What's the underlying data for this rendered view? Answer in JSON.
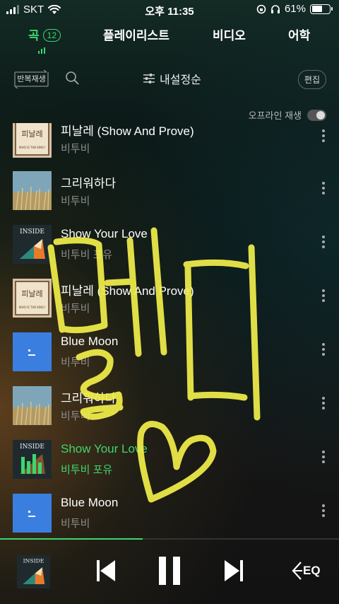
{
  "status_bar": {
    "carrier": "SKT",
    "time": "오후 11:35",
    "battery": "61%",
    "battery_level": 0.61
  },
  "tabs": [
    {
      "label": "곡",
      "badge": "12",
      "active": true
    },
    {
      "label": "플레이리스트"
    },
    {
      "label": "비디오"
    },
    {
      "label": "어학"
    }
  ],
  "toolbar": {
    "repeat_label": "반복재생",
    "sort_label": "내설정순",
    "edit_label": "편집"
  },
  "offline": {
    "label": "오프라인 재생",
    "enabled": false
  },
  "tracks": [
    {
      "title": "피날레 (Show And Prove)",
      "artist": "비투비",
      "art": "finale"
    },
    {
      "title": "그리워하다",
      "artist": "비투비",
      "art": "missing"
    },
    {
      "title": "Show Your Love",
      "artist": "비투비 포유",
      "art": "inside"
    },
    {
      "title": "피날레 (Show And Prove)",
      "artist": "비투비",
      "art": "finale"
    },
    {
      "title": "Blue Moon",
      "artist": "비투비",
      "art": "bluemoon"
    },
    {
      "title": "그리워하다",
      "artist": "비투비",
      "art": "missing"
    },
    {
      "title": "Show Your Love",
      "artist": "비투비 포유",
      "art": "inside",
      "playing": true
    },
    {
      "title": "Blue Moon",
      "artist": "비투비",
      "art": "bluemoon"
    }
  ],
  "album_art_text": {
    "inside": "INSIDE",
    "finale_logo": "피날레",
    "finale_sub": "WHO IS THE KING?"
  },
  "player": {
    "progress": 0.42,
    "cover_text": "INSIDE",
    "eq_label": "EQ"
  },
  "overlay": {
    "handwriting": "멜디♡"
  },
  "colors": {
    "accent": "#3dd66d",
    "handwriting": "#f2ef4a"
  }
}
